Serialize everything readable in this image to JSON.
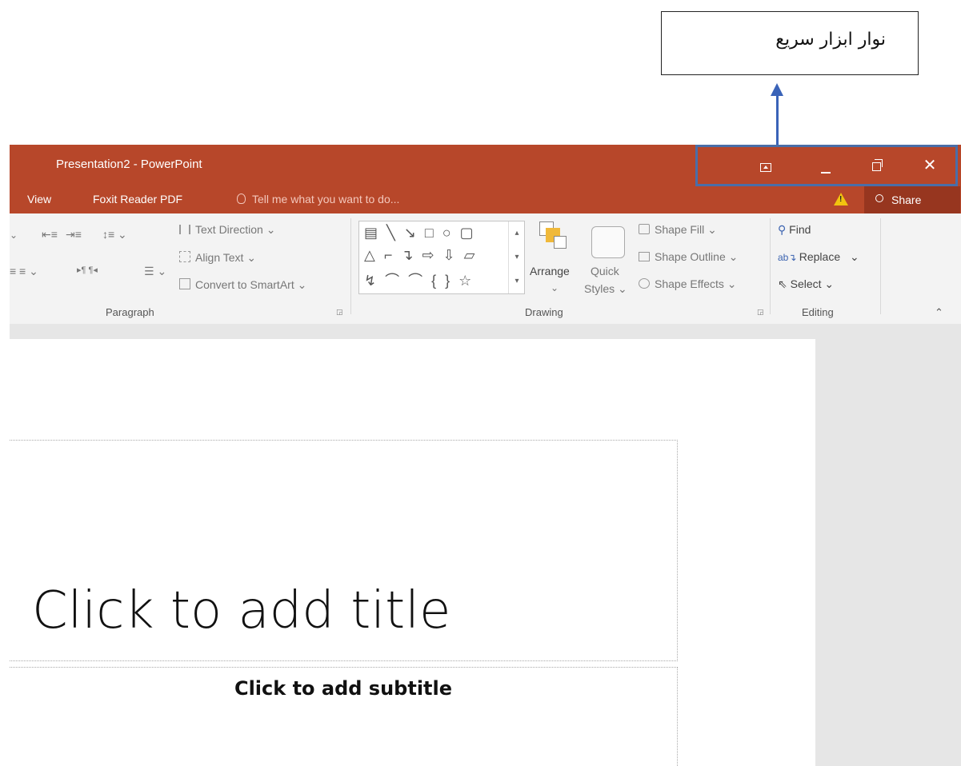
{
  "annotation": {
    "text": "نوار ابزار سریع"
  },
  "titlebar": {
    "app_title": "Presentation2 - PowerPoint",
    "close_glyph": "✕"
  },
  "tabs": {
    "view": "View",
    "foxit": "Foxit Reader PDF",
    "tell_me": "Tell me what you want to do...",
    "warning_glyph": "!",
    "share": "Share"
  },
  "ribbon": {
    "paragraph": {
      "label": "Paragraph",
      "text_direction": "Text Direction",
      "align_text": "Align Text",
      "convert_smartart": "Convert to SmartArt"
    },
    "drawing": {
      "label": "Drawing",
      "shapes_row1": "▤ ╲ ↘ □ ○ ▢",
      "shapes_row2": "△ ⌐ ↴ ⇨ ⇩ ▱",
      "shapes_row3": "↯ ⌒ ⌒ { } ☆",
      "arrange": "Arrange",
      "quick": "Quick",
      "styles": "Styles",
      "shape_fill": "Shape Fill",
      "shape_outline": "Shape Outline",
      "shape_effects": "Shape Effects"
    },
    "editing": {
      "label": "Editing",
      "find": "Find",
      "replace": "Replace",
      "select": "Select"
    }
  },
  "slide": {
    "title_placeholder": "Click to add title",
    "subtitle_placeholder": "Click to add subtitle"
  },
  "colors": {
    "titlebar": "#b7472a",
    "share_bg": "#97361f",
    "highlight": "#4a6ea8",
    "arrow": "#3a63b8"
  }
}
